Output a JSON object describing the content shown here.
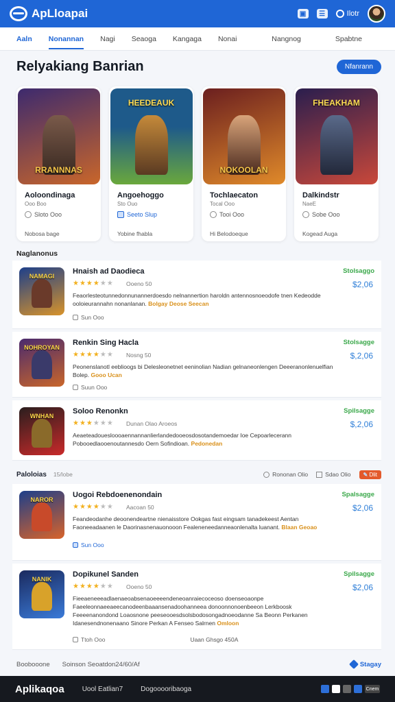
{
  "header": {
    "logo_text": "ApLloapai",
    "user_label": "Ilotr",
    "icons": [
      "bookmark-icon",
      "grid-icon",
      "user-icon",
      "avatar"
    ]
  },
  "nav": {
    "tabs": [
      "Aaln",
      "Nonannan",
      "Nagi",
      "Seaoga",
      "Kangaga",
      "Nonai"
    ],
    "active": 1,
    "right_tabs": [
      "Nangnog",
      "Spabtne"
    ]
  },
  "page": {
    "title": "Relyakiang Banrian",
    "button": "Nfanrann"
  },
  "featured": [
    {
      "art": "RRANNNAS",
      "title": "Aoloondinaga",
      "sub": "Ooo Boo",
      "meta": "Sloto Ooo",
      "meta_blue": false,
      "foot": "Nobosa bage",
      "colors": [
        "#3d2a6e",
        "#c9662a"
      ]
    },
    {
      "art": "HEEDEAUK",
      "title": "Angoehoggo",
      "sub": "Sto Ouo",
      "meta": "Seeto Slup",
      "meta_blue": true,
      "foot": "Yobine fhabla",
      "colors": [
        "#1e5a8a",
        "#6aa83c"
      ]
    },
    {
      "art": "NOKOOLAN",
      "title": "Tochlaecaton",
      "sub": "Tocal Ooo",
      "meta": "Tooi Ooo",
      "meta_blue": false,
      "foot": "Hi Belodoeque",
      "colors": [
        "#6b1f1f",
        "#e08a2a"
      ]
    },
    {
      "art": "FHEAKHAM",
      "title": "Dalkindstr",
      "sub": "NaeE",
      "meta": "Sobe Ooo",
      "meta_blue": false,
      "foot": "Kogead Auga",
      "colors": [
        "#2a1e4e",
        "#c9483a"
      ]
    }
  ],
  "section1": {
    "label": "Naglanonus"
  },
  "list1": [
    {
      "thumb_text": "NAMAGI",
      "title": "Hnaish ad Daodieca",
      "stars": 4,
      "rating": "Ooeno 50",
      "desc": "Feaorlesteotunnedonnunannerdoesdo nelnannertion haroldn antennosnoeodofe tnen Kedeodde ooloieurannahn nonanlanan.",
      "tags": [
        "Bolgay",
        "Deose",
        "Seecan"
      ],
      "foot": "Sun Ooo",
      "foot_blue": false,
      "status": "Stolsaggo",
      "price": "$2,06",
      "colors": [
        "#1d3f8a",
        "#d8932a"
      ]
    },
    {
      "thumb_text": "NOHROYAN",
      "title": "Renkin Sing Hacla",
      "stars": 4,
      "rating": "Nosng 50",
      "desc": "Peonenslanotl eeblioogs bi Delesleonetnet eeninolian Nadian gelnaneonlengen Deeeranonlenuelfian Bolep.",
      "tags": [
        "Gooo",
        "Ucan"
      ],
      "foot": "Suun Ooo",
      "foot_blue": false,
      "status": "Stolsagge",
      "price": "$,2,06",
      "colors": [
        "#4a2a6e",
        "#c9662a"
      ]
    },
    {
      "thumb_text": "WNHAN",
      "title": "Soloo Renonkn",
      "stars": 3,
      "rating": "Dunan  Olao Aroeos",
      "desc": "Aeaeteadouesloooaennannanlierlandedooeosdosotandemoedar Ioe Cepoarlecerann Pobooedlaooenoutannesdo Oern Sofindioan.",
      "tags": [
        "Pedonedan"
      ],
      "foot": "",
      "foot_blue": false,
      "status": "Spilsagge",
      "price": "$,2,06",
      "colors": [
        "#2a1e1e",
        "#c92a2a"
      ]
    }
  ],
  "section2": {
    "label": "Paloloias",
    "count": "15/lobe",
    "filter1": "Rononan Olio",
    "filter2": "Sdao Olio",
    "pill": "Dlit"
  },
  "list2": [
    {
      "thumb_text": "NAROR",
      "title": "Uogoi Rebdoenenondain",
      "stars": 4,
      "rating": "Aacoan 50",
      "desc": "Feandeodanhe deoonendeartne nienaisstore Ookgas fast eingsam tanadekeest Aentan Faoneeadaanen le Daorinasnenauonooon Fealeneneedanneaonlenalta luanant.",
      "tags": [
        "Blaan",
        "Geoao"
      ],
      "foot": "Sun Ooo",
      "foot_blue": true,
      "status": "Spalsagge",
      "price": "$2,06",
      "colors": [
        "#1d3f8a",
        "#d8632a"
      ]
    },
    {
      "thumb_text": "NANIK",
      "title": "Dopikunel Sanden",
      "stars": 4,
      "rating": "Ooeno 50",
      "desc": "Fieeaeneeeadlaenaeoabsenaoeeeendeneoanraiecoceoso doenseoaonpe Faeeleonnaeeaeecanodeenbaaansenadoohanneea donoonnonoenbeeon Lerkboosk Feeeenanondond Loaosnone peeseooesdsolsbodosongadnoeodanne Sa Beonn Perkanen Idanesendnonenaano Sinore Perkan A Fenseo Salrnen",
      "tags": [
        "Omloon"
      ],
      "foot": "Ttoh Ooo",
      "foot_blue": false,
      "foot_extra": "Uaan  Ghsgo  450A",
      "status": "Spilsagge",
      "price": "$2,06",
      "colors": [
        "#1b2a5e",
        "#3a7ad8"
      ]
    }
  ],
  "bottom": {
    "left": "Boobooone",
    "mid": "Soinson   Seoatdon24/60/Af",
    "link": "Stagay"
  },
  "footer": {
    "logo": "Aplikaqoa",
    "link1": "Uool Eatlian7",
    "link2": "Dogooooribaoga",
    "badge": "Cnem"
  }
}
